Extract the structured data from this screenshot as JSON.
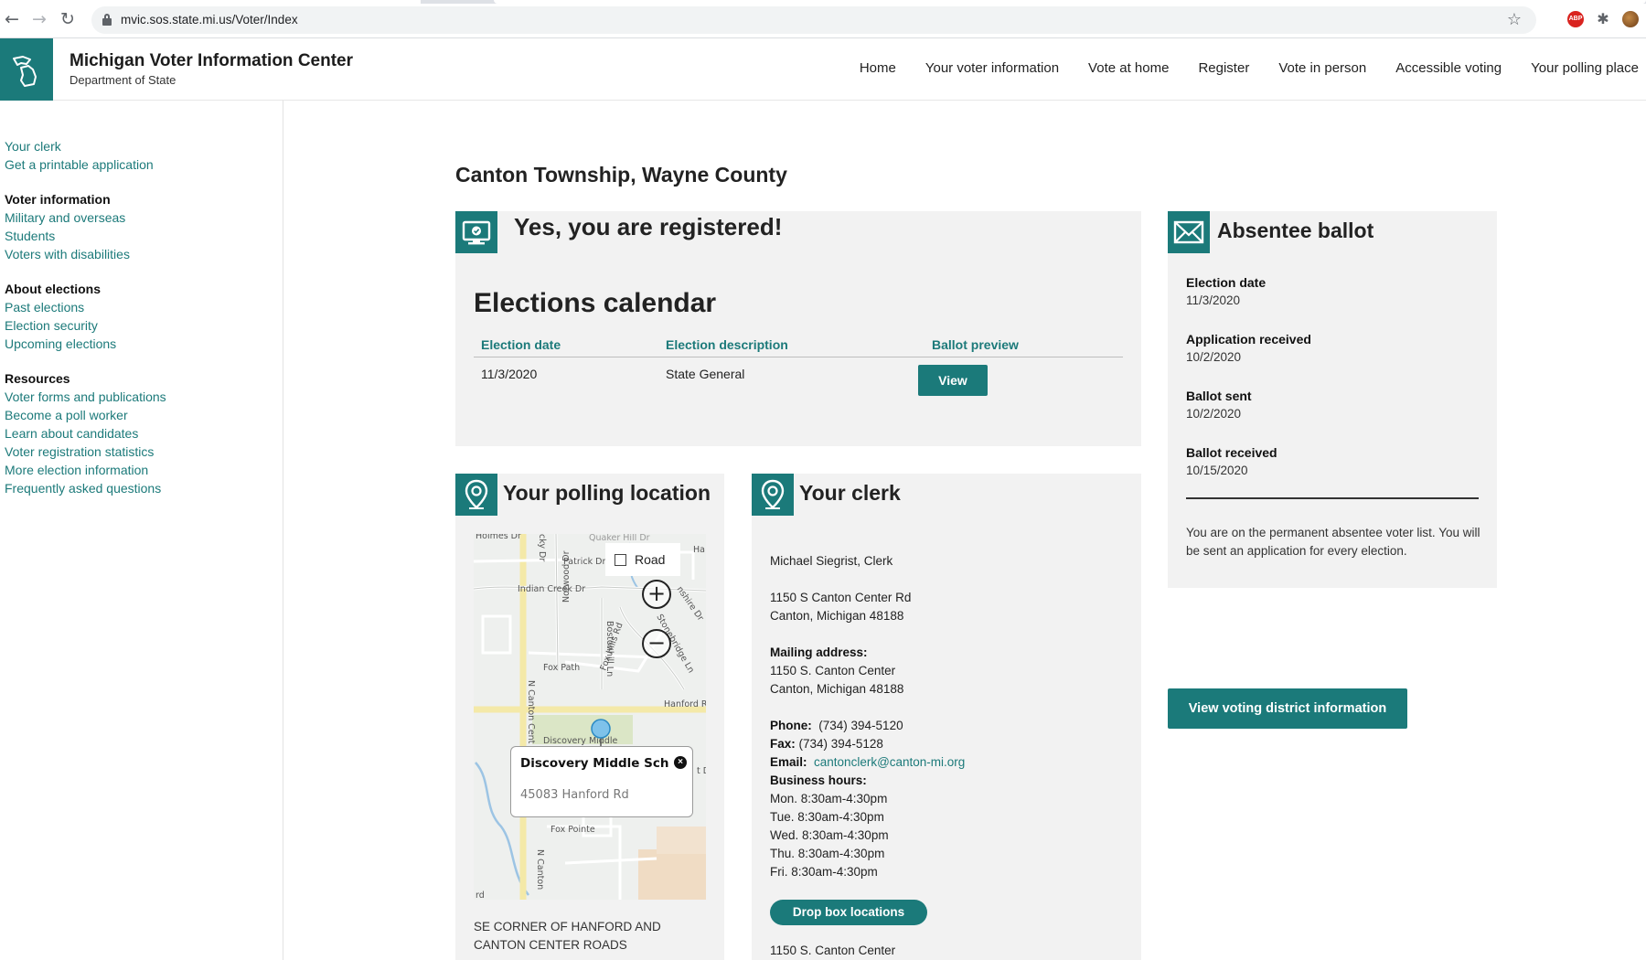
{
  "browser": {
    "url": "mvic.sos.state.mi.us/Voter/Index"
  },
  "header": {
    "title": "Michigan Voter Information Center",
    "subtitle": "Department of State",
    "nav": [
      "Home",
      "Your voter information",
      "Vote at home",
      "Register",
      "Vote in person",
      "Accessible voting",
      "Your polling place"
    ]
  },
  "sidebar": {
    "top_links": [
      "Your clerk",
      "Get a printable application"
    ],
    "groups": [
      {
        "heading": "Voter information",
        "links": [
          "Military and overseas",
          "Students",
          "Voters with disabilities"
        ]
      },
      {
        "heading": "About elections",
        "links": [
          "Past elections",
          "Election security",
          "Upcoming elections"
        ]
      },
      {
        "heading": "Resources",
        "links": [
          "Voter forms and publications",
          "Become a poll worker",
          "Learn about candidates",
          "Voter registration statistics",
          "More election information",
          "Frequently asked questions"
        ]
      }
    ]
  },
  "main": {
    "page_title": "Canton Township, Wayne County",
    "registration": {
      "title": "Yes, you are registered!",
      "calendar_title": "Elections calendar",
      "columns": [
        "Election date",
        "Election description",
        "Ballot preview"
      ],
      "rows": [
        {
          "date": "11/3/2020",
          "description": "State General",
          "action": "View"
        }
      ]
    },
    "absentee": {
      "title": "Absentee ballot",
      "items": [
        {
          "label": "Election date",
          "value": "11/3/2020"
        },
        {
          "label": "Application received",
          "value": "10/2/2020"
        },
        {
          "label": "Ballot sent",
          "value": "10/2/2020"
        },
        {
          "label": "Ballot received",
          "value": "10/15/2020"
        }
      ],
      "note": "You are on the permanent absentee voter list. You will be sent an application for every election."
    },
    "district_button": "View voting district information",
    "polling": {
      "title": "Your polling location",
      "map": {
        "map_type": "Road",
        "popup_name": "Discovery Middle Sch",
        "popup_address": "45083 Hanford Rd",
        "streets": [
          "Holmes Dr",
          "Quaker Hill Dr",
          "Patrick Dr",
          "Indian Creek Dr",
          "Norwood Dr",
          "Bostonhill Ln",
          "Stonebridge Ln",
          "Fox Path",
          "Fox Hills Rd",
          "Hanford Rd",
          "N Canton Center",
          "Discovery Middle",
          "Fox Pointe",
          "N Canton"
        ]
      },
      "address": "SE CORNER OF HANFORD AND CANTON CENTER ROADS"
    },
    "clerk": {
      "title": "Your clerk",
      "name": "Michael Siegrist, Clerk",
      "address_line1": "1150 S Canton Center Rd",
      "address_line2": "Canton, Michigan 48188",
      "mailing_label": "Mailing address:",
      "mailing_line1": "1150 S. Canton Center",
      "mailing_line2": "Canton, Michigan 48188",
      "phone_label": "Phone:",
      "phone": "(734) 394-5120",
      "fax_label": "Fax:",
      "fax": "(734) 394-5128",
      "email_label": "Email:",
      "email": "cantonclerk@canton-mi.org",
      "hours_label": "Business hours:",
      "hours": [
        "Mon. 8:30am-4:30pm",
        "Tue. 8:30am-4:30pm",
        "Wed. 8:30am-4:30pm",
        "Thu. 8:30am-4:30pm",
        "Fri. 8:30am-4:30pm"
      ],
      "dropbox_button": "Drop box locations",
      "dropbox_address": "1150 S. Canton Center"
    }
  },
  "colors": {
    "accent": "#1b7a7a",
    "card_bg": "#f2f2f2",
    "link": "#1c7a7a"
  }
}
